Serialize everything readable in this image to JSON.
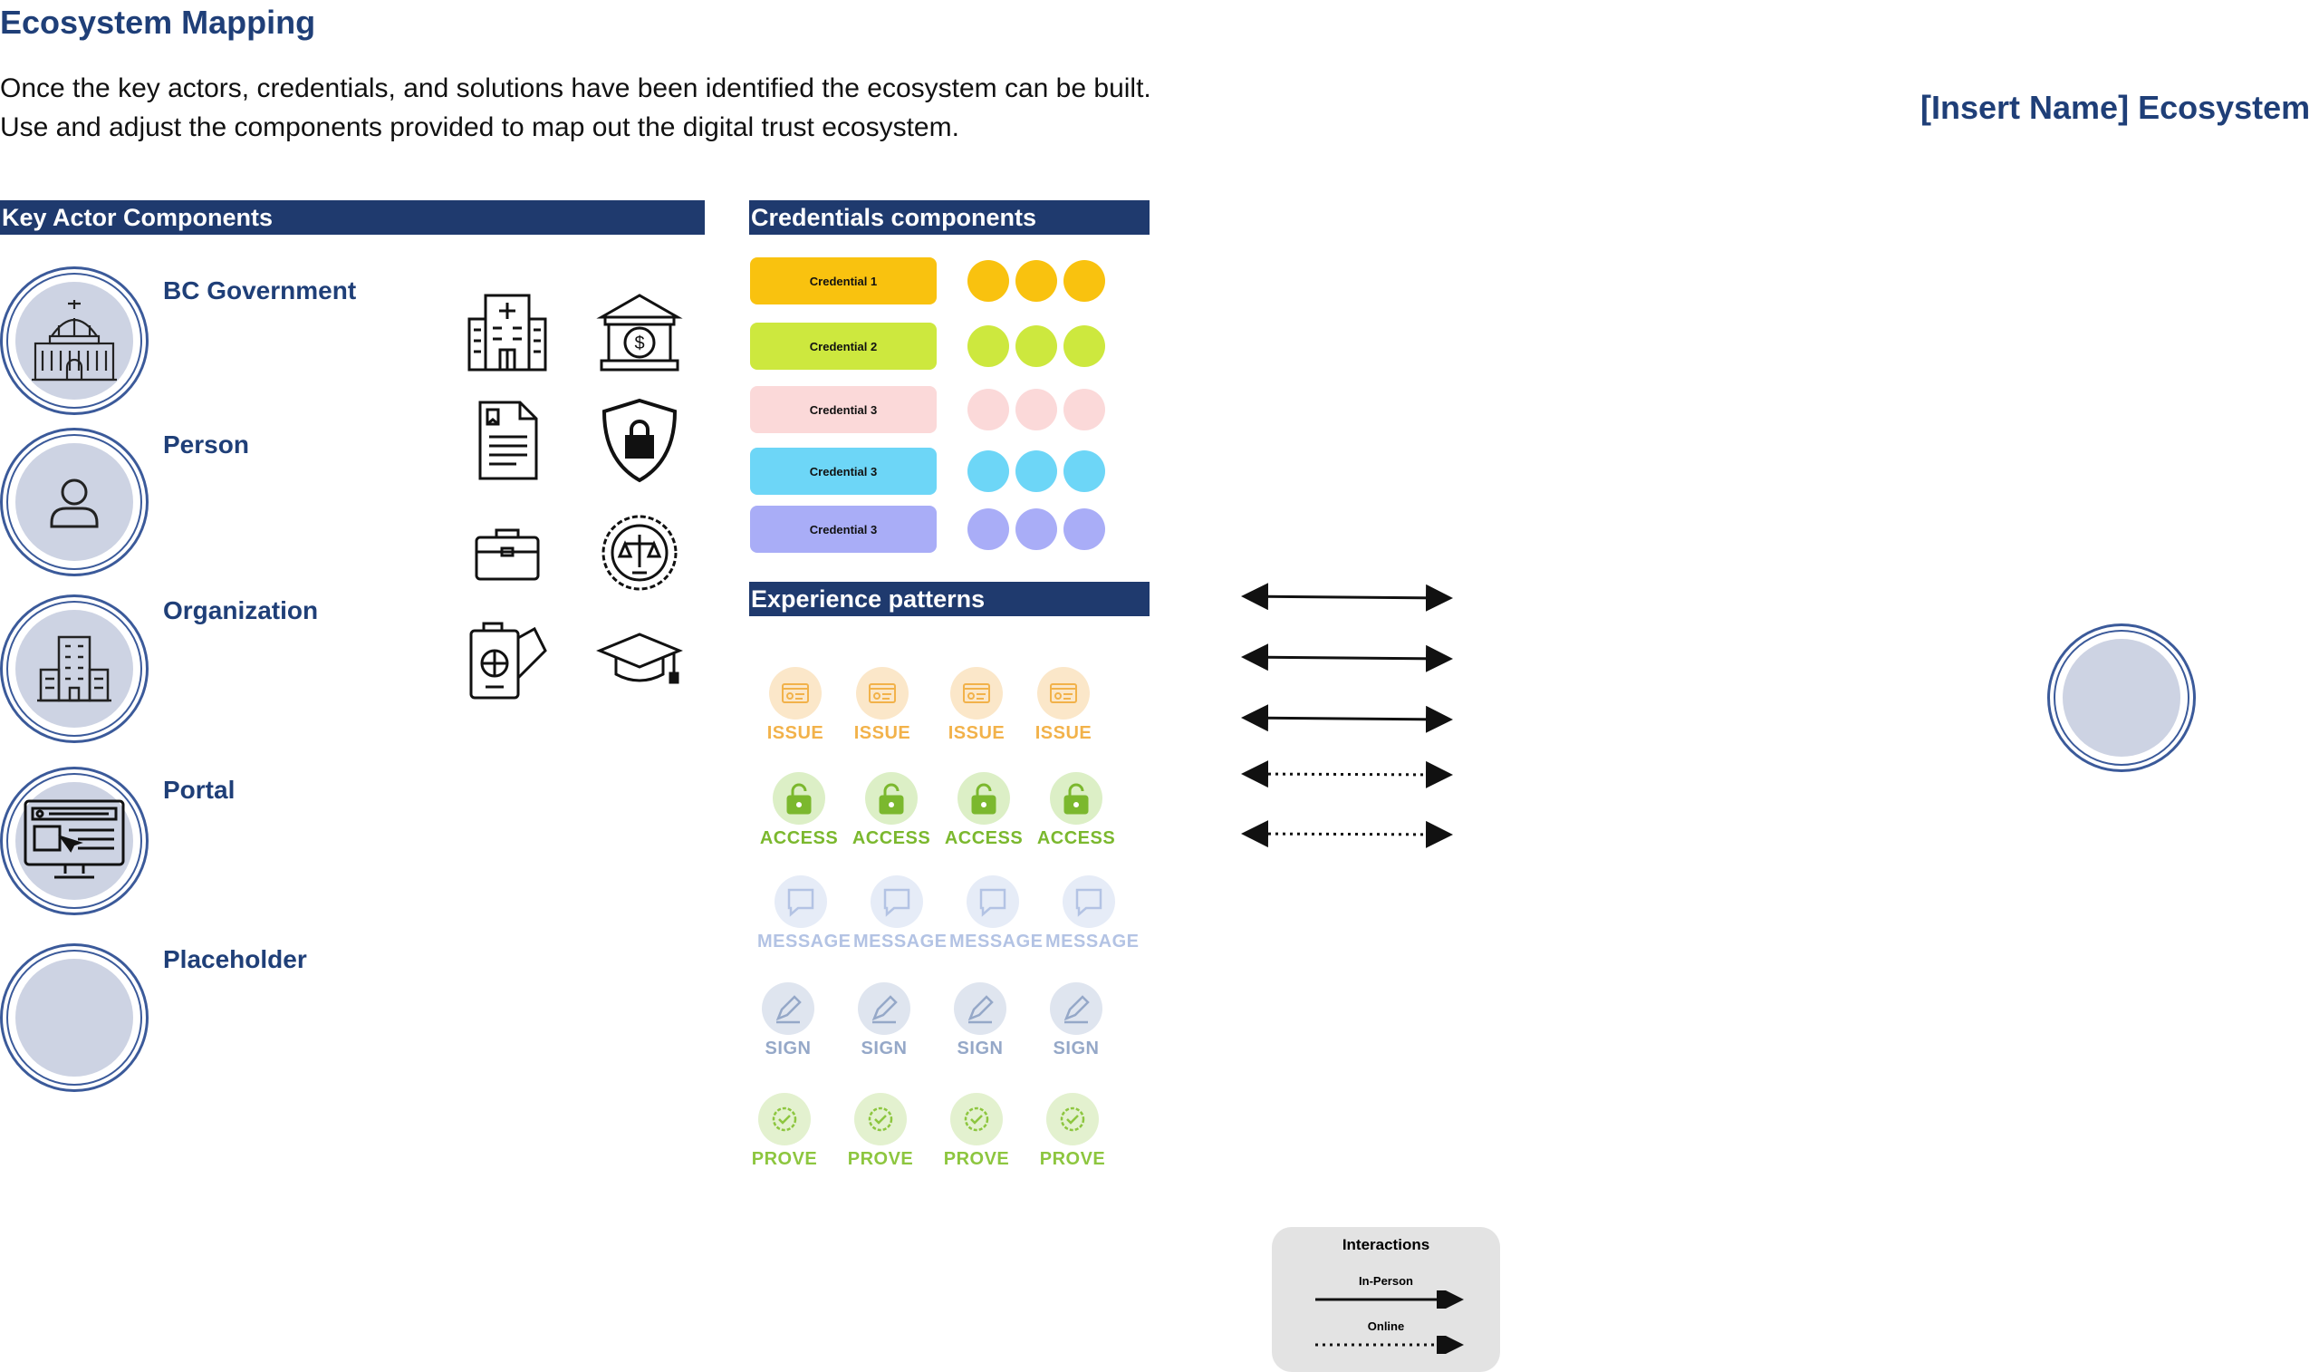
{
  "page": {
    "title": "Ecosystem Mapping",
    "intro_line1": "Once the key actors, credentials, and solutions have been identified the ecosystem can be built.",
    "intro_line2": "Use and adjust the components provided to map out the digital trust ecosystem.",
    "ecosystem_title": "[Insert Name] Ecosystem"
  },
  "sections": {
    "key_actor": "Key Actor Components",
    "credentials": "Credentials components",
    "experience": "Experience patterns"
  },
  "actors": [
    {
      "label": "BC Government",
      "icon": "government-building-icon"
    },
    {
      "label": "Person",
      "icon": "person-icon"
    },
    {
      "label": "Organization",
      "icon": "office-building-icon"
    },
    {
      "label": "Portal",
      "icon": "web-portal-icon"
    },
    {
      "label": "Placeholder",
      "icon": ""
    }
  ],
  "icons": [
    "hospital-icon",
    "bank-icon",
    "document-icon",
    "shield-lock-icon",
    "briefcase-icon",
    "justice-seal-icon",
    "passport-icon",
    "graduation-cap-icon"
  ],
  "credentials": [
    {
      "label": "Credential 1",
      "color": "#f9c20f"
    },
    {
      "label": "Credential 2",
      "color": "#cde83e"
    },
    {
      "label": "Credential 3",
      "color": "#fbd9d9"
    },
    {
      "label": "Credential 3",
      "color": "#6dd6f7"
    },
    {
      "label": "Credential 3",
      "color": "#a9adf7"
    }
  ],
  "patterns": {
    "issue": {
      "label": "ISSUE",
      "color": "#f2b24a",
      "bg": "#fbe7c9",
      "icon": "issue-icon"
    },
    "access": {
      "label": "ACCESS",
      "color": "#7bb82e",
      "bg": "#dcefc6",
      "icon": "unlock-icon"
    },
    "message": {
      "label": "MESSAGE",
      "color": "#b3c3e4",
      "bg": "#e6ecf7",
      "icon": "chat-bubble-icon"
    },
    "sign": {
      "label": "SIGN",
      "color": "#95a8c8",
      "bg": "#dfe5ef",
      "icon": "pen-icon"
    },
    "prove": {
      "label": "PROVE",
      "color": "#8dc63f",
      "bg": "#e3f1cf",
      "icon": "check-badge-icon"
    }
  },
  "legend": {
    "title": "Interactions",
    "in_person": "In-Person",
    "online": "Online"
  },
  "colors": {
    "brand_navy": "#1f3a6e",
    "title_blue": "#1f3f78",
    "actor_fill": "#cdd3e3"
  }
}
